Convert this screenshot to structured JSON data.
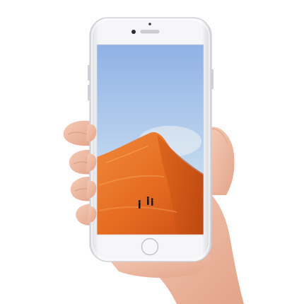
{
  "scene": {
    "subject": "hand-holding-white-smartphone",
    "phone_color": "#f4f4f6",
    "screen_content": "desert-dune-with-hikers",
    "colors": {
      "sky_top": "#8fb2e6",
      "sky_bottom": "#d5e6ef",
      "dune_light": "#ee7a2a",
      "dune_dark": "#c84f14",
      "skin": "#f2c2ab",
      "skin_shadow": "#d89a82"
    }
  }
}
